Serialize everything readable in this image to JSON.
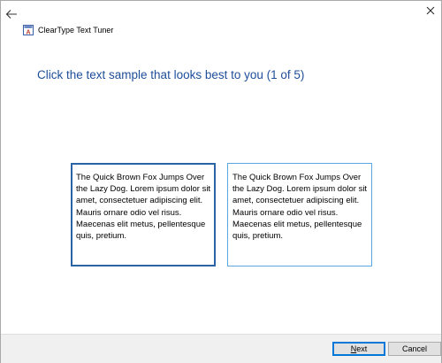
{
  "window": {
    "title": "ClearType Text Tuner"
  },
  "icons": {
    "back": "back-arrow-icon",
    "app": "cleartype-app-icon",
    "close": "close-icon"
  },
  "main": {
    "heading": "Click the text sample that looks best to you (1 of 5)",
    "samples": [
      {
        "text": "The Quick Brown Fox Jumps Over the Lazy Dog. Lorem ipsum dolor sit amet, consectetuer adipiscing elit. Mauris ornare odio vel risus. Maecenas elit metus, pellentesque quis, pretium.",
        "selected": true
      },
      {
        "text": "The Quick Brown Fox Jumps Over the Lazy Dog. Lorem ipsum dolor sit amet, consectetuer adipiscing elit. Mauris ornare odio vel risus. Maecenas elit metus, pellentesque quis, pretium.",
        "selected": false
      }
    ]
  },
  "footer": {
    "next_label": "Next",
    "cancel_label": "Cancel"
  },
  "colors": {
    "heading": "#1e4e9a",
    "selected_border": "#2a64a5",
    "unselected_border": "#5aa6e0",
    "default_button_border": "#0078d7"
  }
}
